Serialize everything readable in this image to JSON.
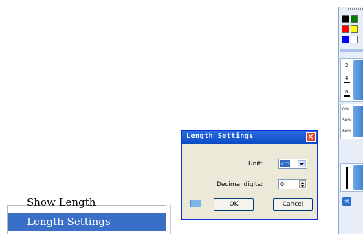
{
  "context_menu": {
    "items": [
      "Show Length",
      "Length Settings"
    ],
    "selected_index": 1,
    "selected_color": "#3a6fc8"
  },
  "dialog": {
    "title": "Length Settings",
    "close_glyph": "✕",
    "unit": {
      "label": "Unit:",
      "value": "cm"
    },
    "decimal": {
      "label": "Decimal digits:",
      "value": "0"
    },
    "buttons": {
      "ok": "OK",
      "cancel": "Cancel"
    },
    "title_color": "#0a4bc6"
  },
  "toolbar": {
    "colors": [
      "#000000",
      "#008000",
      "#ff0000",
      "#ffff00",
      "#0000ff",
      "#ffffff"
    ],
    "line_widths": [
      "2",
      "4",
      "6"
    ],
    "transparency": [
      "0%",
      "50%",
      "80%"
    ],
    "icons": [
      "keyboard-icon",
      "wrench-icon"
    ]
  }
}
